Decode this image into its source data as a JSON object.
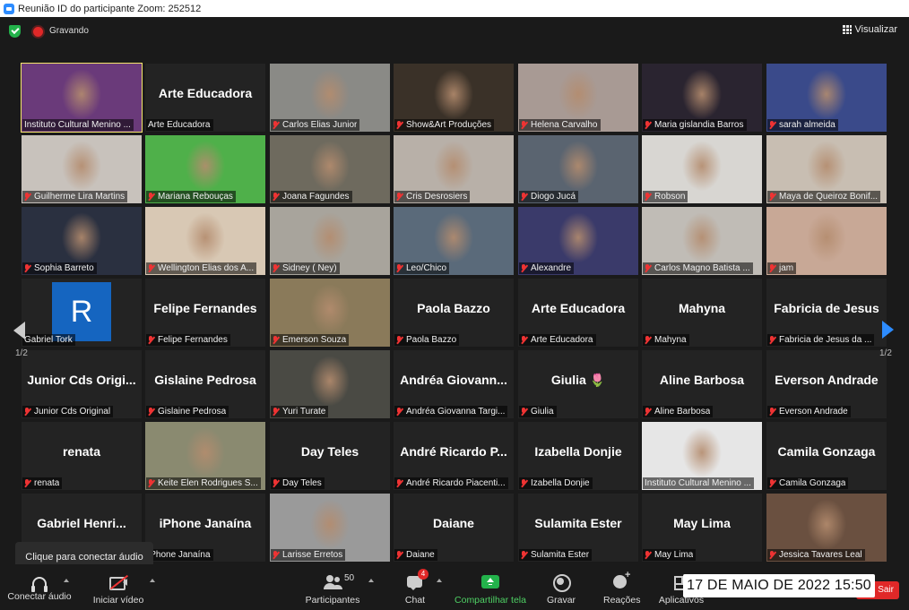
{
  "title_bar": {
    "title": "Reunião ID do participante Zoom: 252512"
  },
  "status": {
    "recording": "Gravando",
    "view_button": "Visualizar"
  },
  "pagination": {
    "left": "1/2",
    "right": "1/2"
  },
  "rows": [
    [
      {
        "name": "Instituto Cultural Menino ...",
        "muted": false,
        "active": true,
        "photo": "#6a3a7a"
      },
      {
        "name": "Arte Educadora",
        "big": "Arte Educadora",
        "muted": false
      },
      {
        "name": "Carlos Elias Junior",
        "muted": true,
        "photo": "#8a8a86"
      },
      {
        "name": "Show&Art Produções",
        "muted": true,
        "photo": "#3a3128"
      },
      {
        "name": "Helena Carvalho",
        "muted": true,
        "photo": "#a89a94"
      },
      {
        "name": "Maria gislandia Barros",
        "muted": true,
        "photo": "#2a2430"
      },
      {
        "name": "sarah almeida",
        "muted": true,
        "photo": "#3a4a8a"
      }
    ],
    [
      {
        "name": "Guilherme Lira Martins",
        "muted": true,
        "photo": "#c8c2bc"
      },
      {
        "name": "Mariana Rebouças",
        "muted": true,
        "photo": "#4fb04a"
      },
      {
        "name": "Joana Fagundes",
        "muted": true,
        "photo": "#6e6a5e"
      },
      {
        "name": "Cris Desrosiers",
        "muted": true,
        "photo": "#b8b0a8"
      },
      {
        "name": "Diogo Jucá",
        "muted": true,
        "photo": "#5a6470"
      },
      {
        "name": "Robson",
        "muted": true,
        "photo": "#d8d6d2"
      },
      {
        "name": "Maya de Queiroz Bonif...",
        "muted": true,
        "photo": "#c8beb2"
      }
    ],
    [
      {
        "name": "Sophia Barreto",
        "muted": true,
        "photo": "#2a3040"
      },
      {
        "name": "Wellington Elias dos A...",
        "muted": true,
        "photo": "#d8c8b4"
      },
      {
        "name": "Sidney ( Ney)",
        "muted": true,
        "photo": "#a8a49c"
      },
      {
        "name": "Leo/Chico",
        "muted": true,
        "photo": "#5a6a7a"
      },
      {
        "name": "Alexandre",
        "muted": true,
        "photo": "#3a3a6a"
      },
      {
        "name": "Carlos Magno Batista ...",
        "muted": true,
        "photo": "#c0bcb6"
      },
      {
        "name": "jam",
        "muted": true,
        "photo": "#c8a896"
      }
    ],
    [
      {
        "name": "Gabriel Tork",
        "muted": false,
        "avatar": "R"
      },
      {
        "name": "Felipe Fernandes",
        "big": "Felipe Fernandes",
        "muted": true
      },
      {
        "name": "Emerson Souza",
        "muted": true,
        "photo": "#8a7a5a"
      },
      {
        "name": "Paola Bazzo",
        "big": "Paola Bazzo",
        "muted": true
      },
      {
        "name": "Arte Educadora",
        "big": "Arte Educadora",
        "muted": true
      },
      {
        "name": "Mahyna",
        "big": "Mahyna",
        "muted": true
      },
      {
        "name": "Fabricia de Jesus da ...",
        "big": "Fabricia de Jesus",
        "muted": true
      }
    ],
    [
      {
        "name": "Junior Cds Original",
        "big": "Junior Cds Origi...",
        "muted": true
      },
      {
        "name": "Gislaine Pedrosa",
        "big": "Gislaine Pedrosa",
        "muted": true
      },
      {
        "name": "Yuri Turate",
        "muted": true,
        "photo": "#4a4a44"
      },
      {
        "name": "Andréa Giovanna Targi...",
        "big": "Andréa Giovann...",
        "muted": true
      },
      {
        "name": "Giulia",
        "big": "Giulia 🌷",
        "muted": true
      },
      {
        "name": "Aline Barbosa",
        "big": "Aline Barbosa",
        "muted": true
      },
      {
        "name": "Everson Andrade",
        "big": "Everson Andrade",
        "muted": true
      }
    ],
    [
      {
        "name": "renata",
        "big": "renata",
        "muted": true
      },
      {
        "name": "Keite Elen Rodrigues S...",
        "muted": true,
        "photo": "#8a8a70"
      },
      {
        "name": "Day Teles",
        "big": "Day Teles",
        "muted": true
      },
      {
        "name": "André Ricardo Piacenti...",
        "big": "André Ricardo P...",
        "muted": true
      },
      {
        "name": "Izabella Donjie",
        "big": "Izabella Donjie",
        "muted": true
      },
      {
        "name": "Instituto Cultural Menino ...",
        "muted": false,
        "photo": "#e6e6e6"
      },
      {
        "name": "Camila Gonzaga",
        "big": "Camila Gonzaga",
        "muted": true
      }
    ],
    [
      {
        "name": "",
        "big": "Gabriel Henri...",
        "muted": false
      },
      {
        "name": "iPhone Janaína",
        "big": "iPhone Janaína",
        "muted": false
      },
      {
        "name": "Larisse Erretos",
        "muted": true,
        "photo": "#9a9a9a"
      },
      {
        "name": "Daiane",
        "big": "Daiane",
        "muted": true
      },
      {
        "name": "Sulamita Ester",
        "big": "Sulamita Ester",
        "muted": true
      },
      {
        "name": "May Lima",
        "big": "May Lima",
        "muted": true
      },
      {
        "name": "Jessica Tavares Leal",
        "muted": true,
        "photo": "#6a5040"
      }
    ]
  ],
  "tooltip": "Clique para conectar áudio",
  "toolbar": {
    "audio": "Conectar áudio",
    "video": "Iniciar vídeo",
    "participants": "Participantes",
    "participants_count": "50",
    "chat": "Chat",
    "chat_badge": "4",
    "share": "Compartilhar tela",
    "record": "Gravar",
    "reactions": "Reações",
    "apps": "Aplicativos",
    "end": "Sair"
  },
  "datestamp": "17 DE MAIO DE 2022 15:50"
}
